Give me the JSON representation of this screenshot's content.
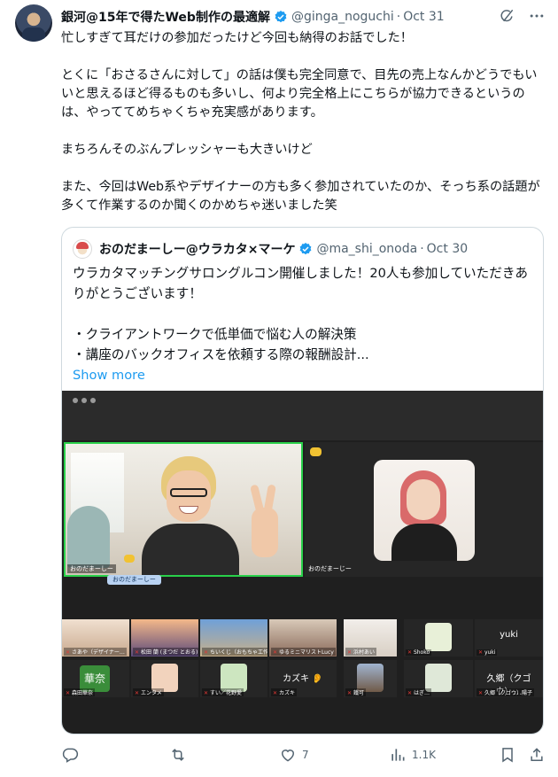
{
  "tweet": {
    "author_name": "銀河@15年で得たWeb制作の最適解",
    "author_handle": "@ginga_noguchi",
    "separator": "·",
    "date": "Oct 31",
    "text_lines": [
      "忙しすぎて耳だけの参加だったけど今回も納得のお話でした！",
      "とくに「おさるさんに対して」の話は僕も完全同意で、目先の売上なんかどうでもいいと思えるほど得るものも多いし、何より完全格上にこちらが協力できるというのは、やっててめちゃくちゃ充実感があります。",
      "まちろんそのぶんプレッシャーも大きいけど",
      "また、今回はWeb系やデザイナーの方も多く参加されていたのか、そっち系の話題が多くて作業するのか聞くのかめちゃ迷いました笑"
    ]
  },
  "quote": {
    "author_name": "おのだまーしー@ウラカタ×マーケ",
    "author_handle": "@ma_shi_onoda",
    "separator": "·",
    "date": "Oct 30",
    "text_lines": [
      "ウラカタマッチングサロングルコン開催しました！20人も参加していただきありがとうございます！",
      "・クライアントワークで低単価で悩む人の解決策",
      "・講座のバックオフィスを依頼する際の報酬設計..."
    ],
    "show_more": "Show more"
  },
  "zoom": {
    "speaker_label": "おのだまーしー",
    "speaker_nametag": "おのだまーしー",
    "second_label": "おのだまーじー",
    "participants_row1": [
      "さあや（デザイナー…",
      "松田 蘭 (まつだ とおる)",
      "ちいくじ（おもちゃ工作…",
      "ゆるミニマリストLucy",
      "浜村あい",
      "Shoko",
      "yuki"
    ],
    "participants_row2": [
      "森田華奈",
      "エンタメ",
      "すい／花野愛",
      "カズキ",
      "鐵可",
      "はぎ…",
      "久郷（クゴウ）陽子"
    ],
    "tile_texts": {
      "yuki": "yuki",
      "kanji": "華奈",
      "kazuki": "カズキ 👂",
      "kugou": "久郷（クゴウ）…"
    }
  },
  "actions": {
    "reply_count": "",
    "retweet_count": "",
    "like_count": "7",
    "views_count": "1.1K"
  },
  "colors": {
    "accent": "#1d9bf0",
    "muted": "#536471",
    "border": "#cfd9de",
    "speaker_border": "#29d04a"
  },
  "icons": [
    "verified-badge-icon",
    "grok-icon",
    "more-icon",
    "reply-icon",
    "retweet-icon",
    "like-icon",
    "views-icon",
    "bookmark-icon",
    "share-icon"
  ]
}
